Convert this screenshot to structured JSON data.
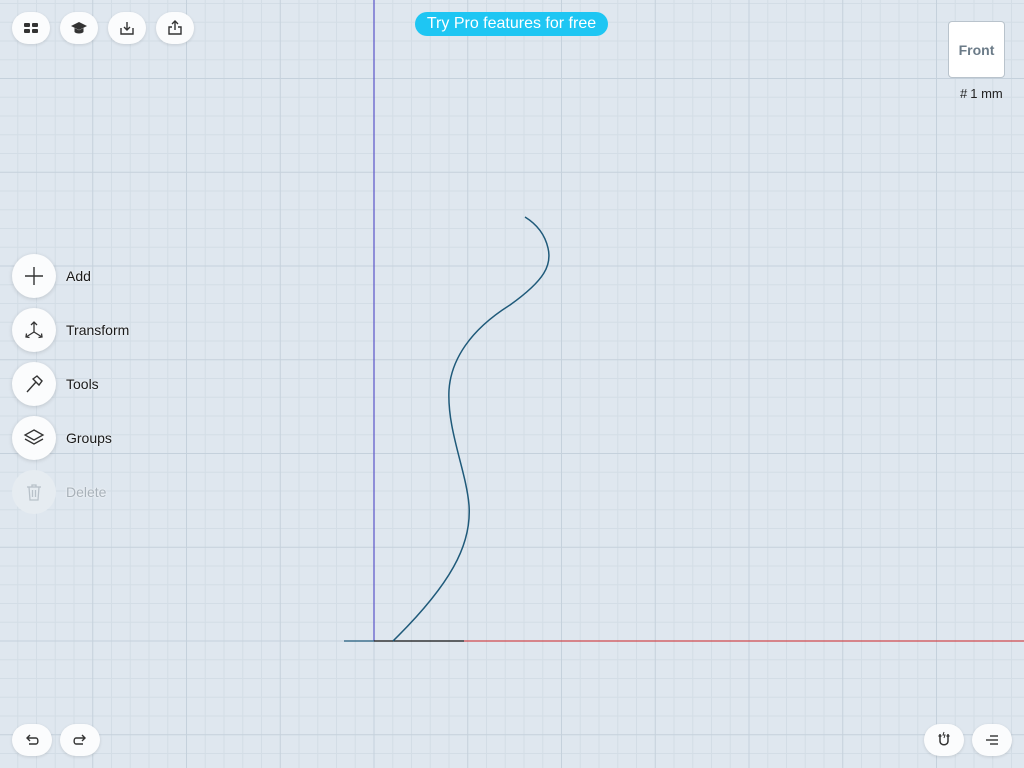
{
  "toolbar": {
    "items": [
      {
        "name": "projects-button",
        "icon": "grid-icon"
      },
      {
        "name": "learn-button",
        "icon": "graduation-cap-icon"
      },
      {
        "name": "import-button",
        "icon": "import-icon"
      },
      {
        "name": "export-button",
        "icon": "share-icon"
      }
    ]
  },
  "promo": {
    "label": "Try Pro features for free"
  },
  "view_cube": {
    "face_label": "Front"
  },
  "grid": {
    "size_label": "1 mm"
  },
  "side_menu": {
    "items": [
      {
        "label": "Add",
        "icon": "plus-icon",
        "enabled": true
      },
      {
        "label": "Transform",
        "icon": "transform-icon",
        "enabled": true
      },
      {
        "label": "Tools",
        "icon": "hammer-icon",
        "enabled": true
      },
      {
        "label": "Groups",
        "icon": "layers-icon",
        "enabled": true
      },
      {
        "label": "Delete",
        "icon": "trash-icon",
        "enabled": false
      }
    ]
  },
  "bottom_bar": {
    "left": [
      {
        "name": "undo-button",
        "icon": "undo-icon"
      },
      {
        "name": "redo-button",
        "icon": "redo-icon"
      }
    ],
    "right": [
      {
        "name": "snap-button",
        "icon": "magnet-icon"
      },
      {
        "name": "menu-button",
        "icon": "menu-lines-icon"
      }
    ]
  },
  "colors": {
    "background": "#dfe7ef",
    "grid_minor": "#d3dde6",
    "grid_major": "#c5d1dc",
    "y_axis": "#5a54c9",
    "x_axis": "#d0494e",
    "curve": "#1f5a7a",
    "accent": "#1ec6f3"
  }
}
